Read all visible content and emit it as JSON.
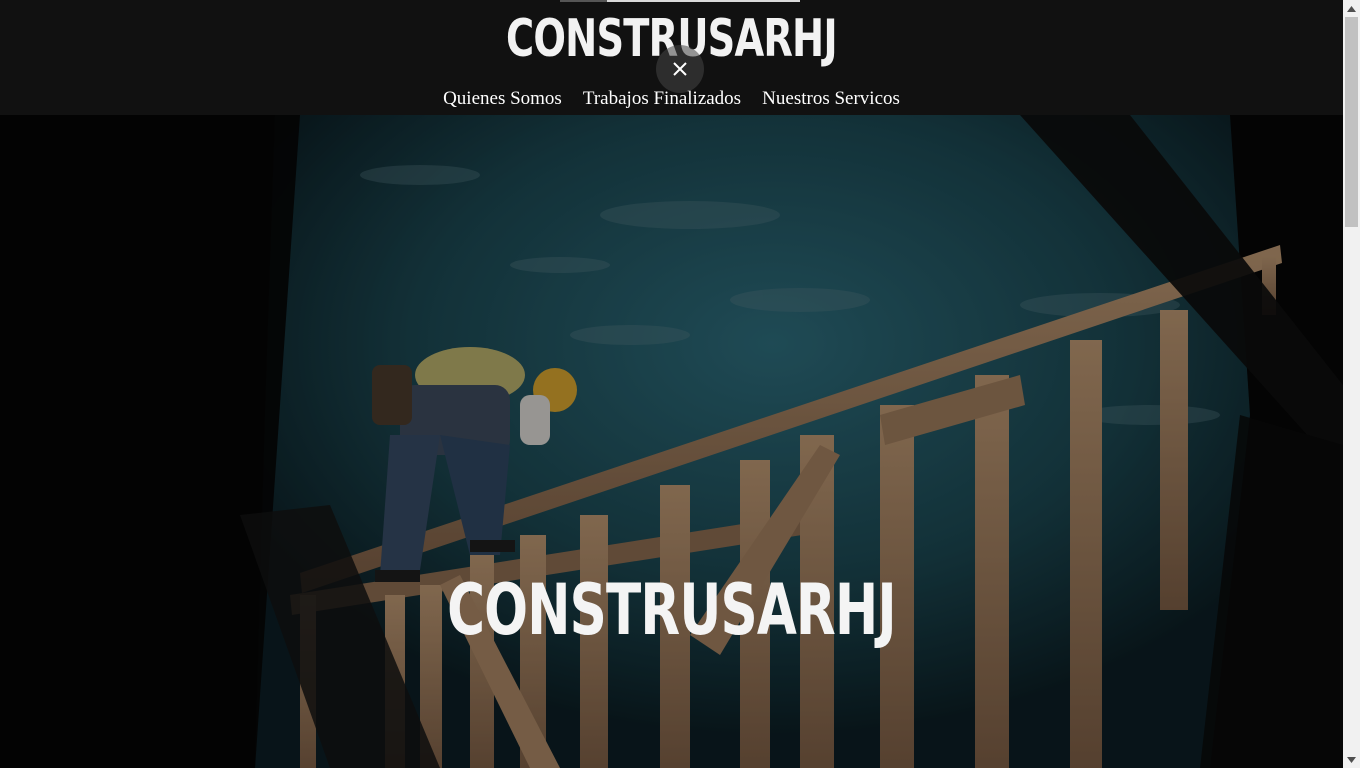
{
  "brand": {
    "logo_text": "CONSTRUSARHJ"
  },
  "nav": {
    "items": [
      {
        "label": "Quienes Somos"
      },
      {
        "label": "Trabajos Finalizados"
      },
      {
        "label": "Nuestros Servicos"
      }
    ]
  },
  "hero": {
    "title": "CONSTRUSARHJ"
  },
  "icons": {
    "close": "close-icon",
    "scroll_up": "arrow-up-icon",
    "scroll_down": "arrow-down-icon"
  },
  "colors": {
    "header_bg": "#111111",
    "text": "#ffffff",
    "sky": "#1d4a57",
    "wood": "#c9a27a"
  }
}
